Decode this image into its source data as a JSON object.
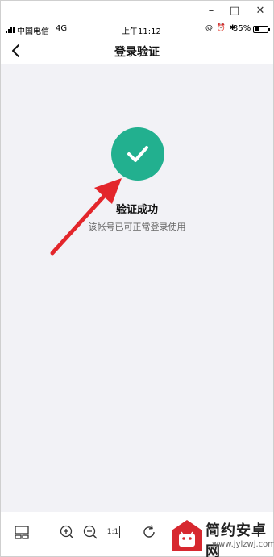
{
  "window": {
    "minimize_symbol": "–",
    "maximize_symbol": "□",
    "close_symbol": "✕"
  },
  "status_bar": {
    "carrier": "中国电信",
    "network": "4G",
    "time": "上午11:12",
    "icons": "@ ⏰ ✱",
    "battery_percent": "35%"
  },
  "nav": {
    "title": "登录验证"
  },
  "result": {
    "title": "验证成功",
    "subtitle": "该帐号已可正常登录使用"
  },
  "toolbar": {
    "actual_size_label": "1:1"
  },
  "watermark": {
    "title": "简约安卓网",
    "url": "www.jylzwj.com"
  },
  "colors": {
    "success_green": "#22b08f",
    "arrow_red": "#e3262b",
    "background": "#f2f2f6"
  }
}
